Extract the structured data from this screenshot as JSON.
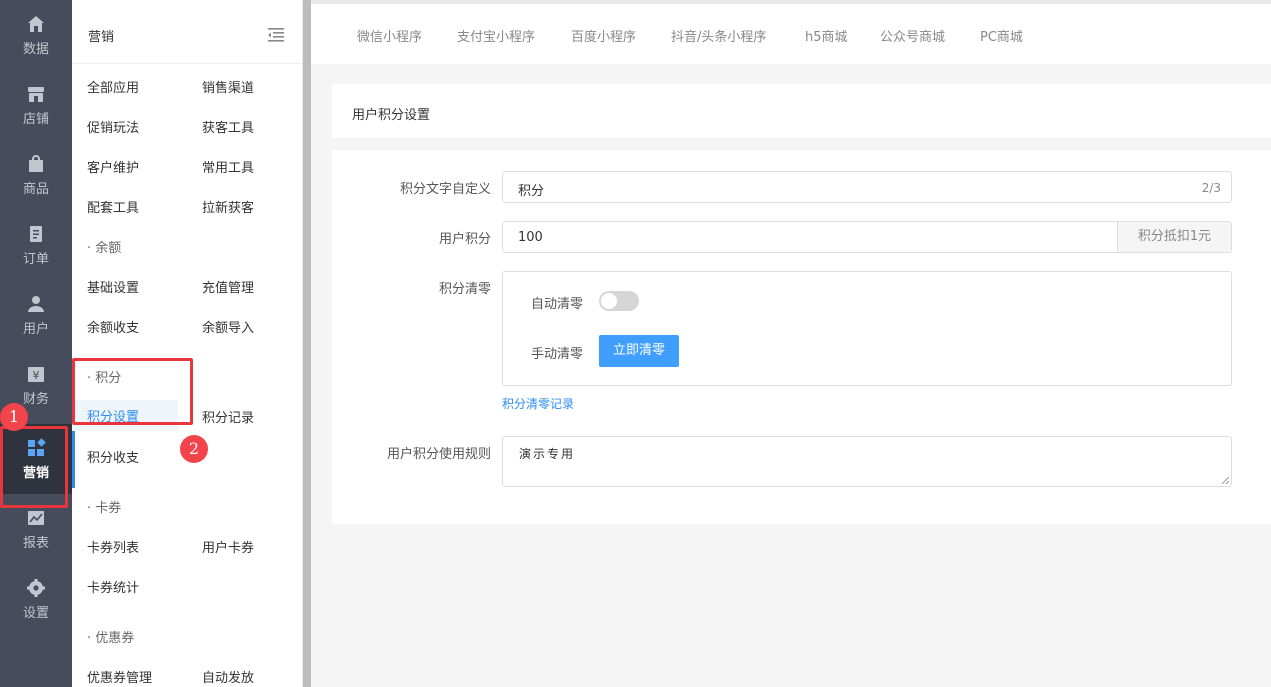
{
  "nav": {
    "items": [
      {
        "label": "数据",
        "icon": "home-icon"
      },
      {
        "label": "店铺",
        "icon": "store-icon"
      },
      {
        "label": "商品",
        "icon": "bag-icon"
      },
      {
        "label": "订单",
        "icon": "order-icon"
      },
      {
        "label": "用户",
        "icon": "user-icon"
      },
      {
        "label": "财务",
        "icon": "yen-icon"
      },
      {
        "label": "营销",
        "icon": "apps-icon"
      },
      {
        "label": "报表",
        "icon": "chart-icon"
      },
      {
        "label": "设置",
        "icon": "gear-icon"
      }
    ],
    "active_color": "#2d8cf0"
  },
  "submenu": {
    "title": "营销",
    "rows": [
      [
        "全部应用",
        "销售渠道"
      ],
      [
        "促销玩法",
        "获客工具"
      ],
      [
        "客户维护",
        "常用工具"
      ],
      [
        "配套工具",
        "拉新获客"
      ]
    ],
    "groups": {
      "balance": {
        "title": "· 余额",
        "items": [
          "基础设置",
          "充值管理",
          "余额收支",
          "余额导入"
        ]
      },
      "points": {
        "title": "· 积分",
        "items": [
          "积分设置",
          "积分记录",
          "积分收支"
        ]
      },
      "coupon_card": {
        "title": "· 卡券",
        "items": [
          "卡券列表",
          "用户卡券",
          "卡券统计"
        ]
      },
      "discount": {
        "title": "· 优惠券",
        "items": [
          "优惠券管理",
          "自动发放"
        ]
      }
    }
  },
  "tabs": [
    "微信小程序",
    "支付宝小程序",
    "百度小程序",
    "抖音/头条小程序",
    "h5商城",
    "公众号商城",
    "PC商城"
  ],
  "page": {
    "title": "用户积分设置",
    "form": {
      "custom_text_label": "积分文字自定义",
      "custom_text_value": "积分",
      "custom_text_count": "2/3",
      "user_points_label": "用户积分",
      "user_points_value": "100",
      "user_points_addon": "积分抵扣1元",
      "clear_label": "积分清零",
      "auto_clear_label": "自动清零",
      "manual_clear_label": "手动清零",
      "clear_now_button": "立即清零",
      "clear_record_link": "积分清零记录",
      "rules_label": "用户积分使用规则",
      "rules_value": "演示专用"
    }
  },
  "annotations": {
    "one": "1",
    "two": "2",
    "color": "#e8363c"
  }
}
